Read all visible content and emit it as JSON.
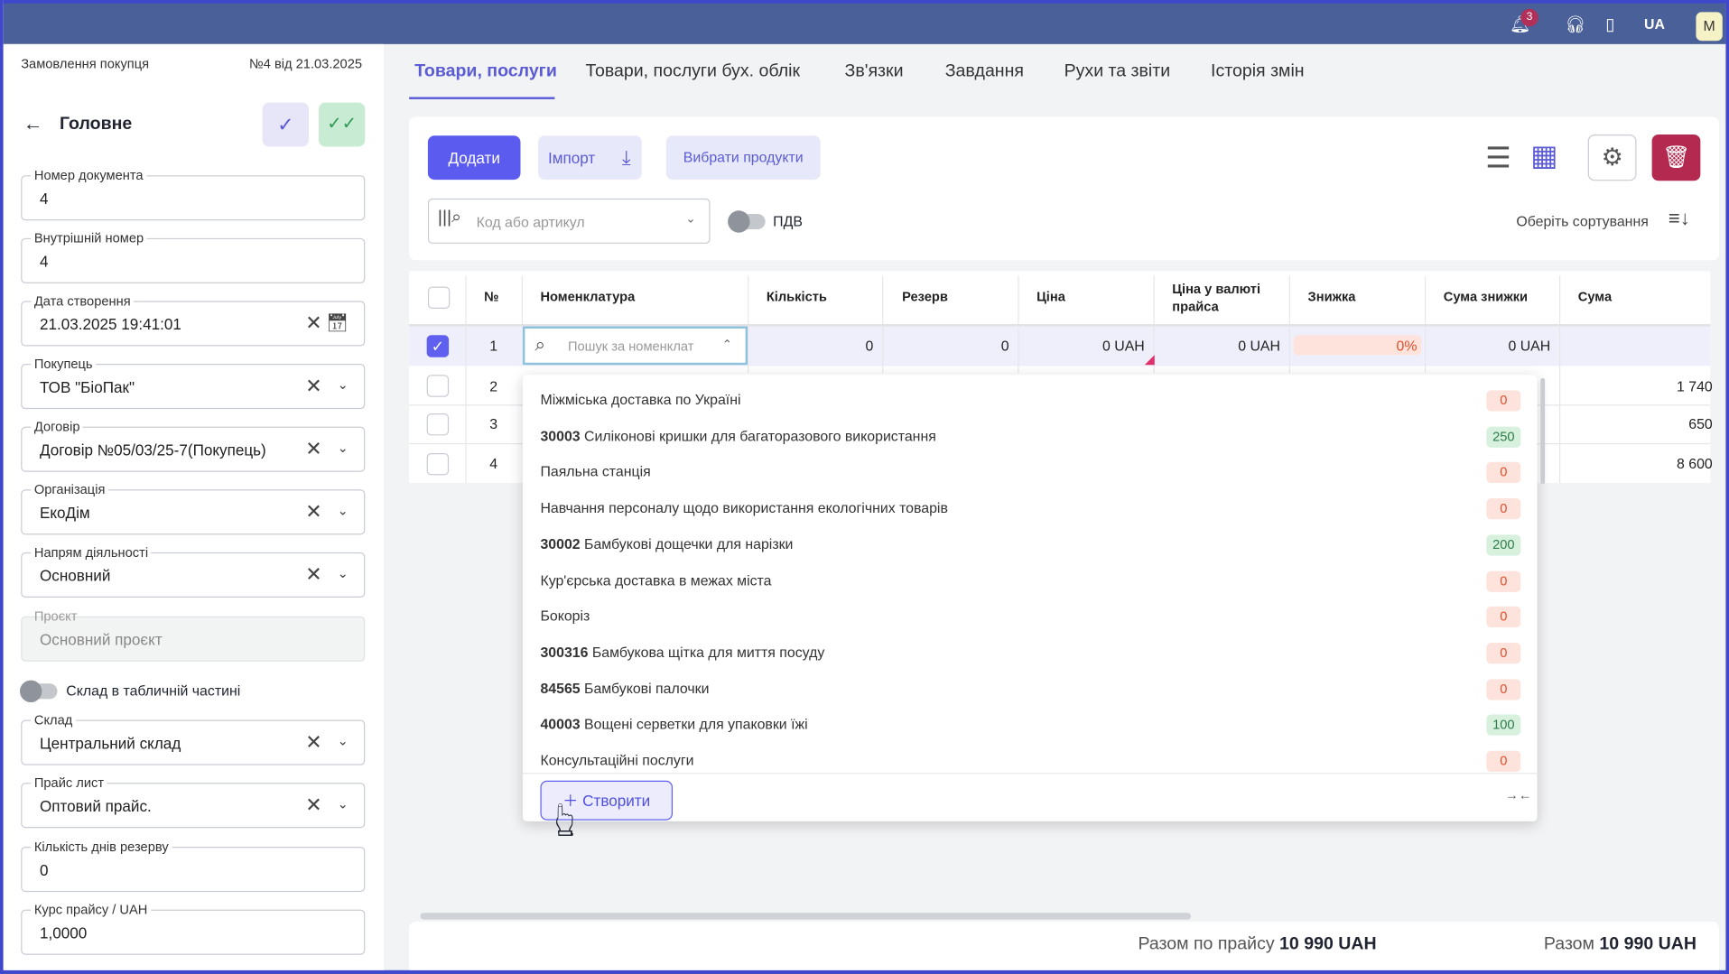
{
  "topbar": {
    "notifications_count": "3",
    "lang": "UA",
    "avatar": "M"
  },
  "left": {
    "doc_type": "Замовлення покупця",
    "doc_number": "№4 від 21.03.2025",
    "title": "Головне",
    "fields": [
      {
        "label": "Номер документа",
        "value": "4"
      },
      {
        "label": "Внутрішній номер",
        "value": "4"
      },
      {
        "label": "Дата створення",
        "value": "21.03.2025 19:41:01"
      },
      {
        "label": "Покупець",
        "value": "ТОВ \"БіоПак\""
      },
      {
        "label": "Договір",
        "value": "Договір №05/03/25-7(Покупець)"
      },
      {
        "label": "Організація",
        "value": "ЕкоДім"
      },
      {
        "label": "Напрям діяльності",
        "value": "Основний"
      },
      {
        "label": "Проєкт",
        "value": "Основний проєкт"
      },
      {
        "label": "Склад",
        "value": "Центральний склад"
      },
      {
        "label": "Прайс лист",
        "value": "Оптовий прайс."
      },
      {
        "label": "Кількість днів резерву",
        "value": "0"
      },
      {
        "label": "Курс прайсу / UAH",
        "value": "1,0000"
      }
    ],
    "warehouse_toggle": "Склад в табличній частині"
  },
  "tabs": [
    "Товари, послуги",
    "Товари, послуги бух. облік",
    "Зв'язки",
    "Завдання",
    "Рухи та звіти",
    "Історія змін"
  ],
  "toolbar": {
    "add": "Додати",
    "import": "Імпорт",
    "choose": "Вибрати продукти",
    "search_placeholder": "Код або артикул",
    "vat": "ПДВ",
    "sort": "Оберіть сортування"
  },
  "table": {
    "headers": [
      "№",
      "Номенклатура",
      "Кількість",
      "Резерв",
      "Ціна",
      "Ціна у валюті прайса",
      "Знижка",
      "Сума знижки",
      "Сума"
    ],
    "row1": {
      "n": "1",
      "search_placeholder": "Пошук за номенклат",
      "qty": "0",
      "reserve": "0",
      "price": "0  UAH",
      "price_list": "0  UAH",
      "discount": "0%",
      "discount_sum": "0  UAH"
    },
    "rows": [
      {
        "n": "2",
        "sum": "1 740"
      },
      {
        "n": "3",
        "sum": "650"
      },
      {
        "n": "4",
        "sum": "8 600"
      }
    ]
  },
  "dropdown": {
    "items": [
      {
        "code": "",
        "name": "Міжміська доставка по Україні",
        "stock": "0"
      },
      {
        "code": "30003",
        "name": "Силіконові кришки для багаторазового використання",
        "stock": "250"
      },
      {
        "code": "",
        "name": "Паяльна станція",
        "stock": "0"
      },
      {
        "code": "",
        "name": "Навчання персоналу щодо використання екологічних товарів",
        "stock": "0"
      },
      {
        "code": "30002",
        "name": "Бамбукові дощечки для нарізки",
        "stock": "200"
      },
      {
        "code": "",
        "name": "Кур'єрська доставка в межах міста",
        "stock": "0"
      },
      {
        "code": "",
        "name": "Бокоріз",
        "stock": "0"
      },
      {
        "code": "300316",
        "name": "Бамбукова щітка для миття посуду",
        "stock": "0"
      },
      {
        "code": "84565",
        "name": "Бамбукові палочки",
        "stock": "0"
      },
      {
        "code": "40003",
        "name": "Вощені серветки для упаковки їжі",
        "stock": "100"
      },
      {
        "code": "",
        "name": "Консультаційні послуги",
        "stock": "0"
      }
    ],
    "create": "Створити"
  },
  "footer": {
    "price_total_label": "Разом по прайсу",
    "price_total": "10 990 UAH",
    "total_label": "Разом",
    "total": "10 990 UAH"
  }
}
